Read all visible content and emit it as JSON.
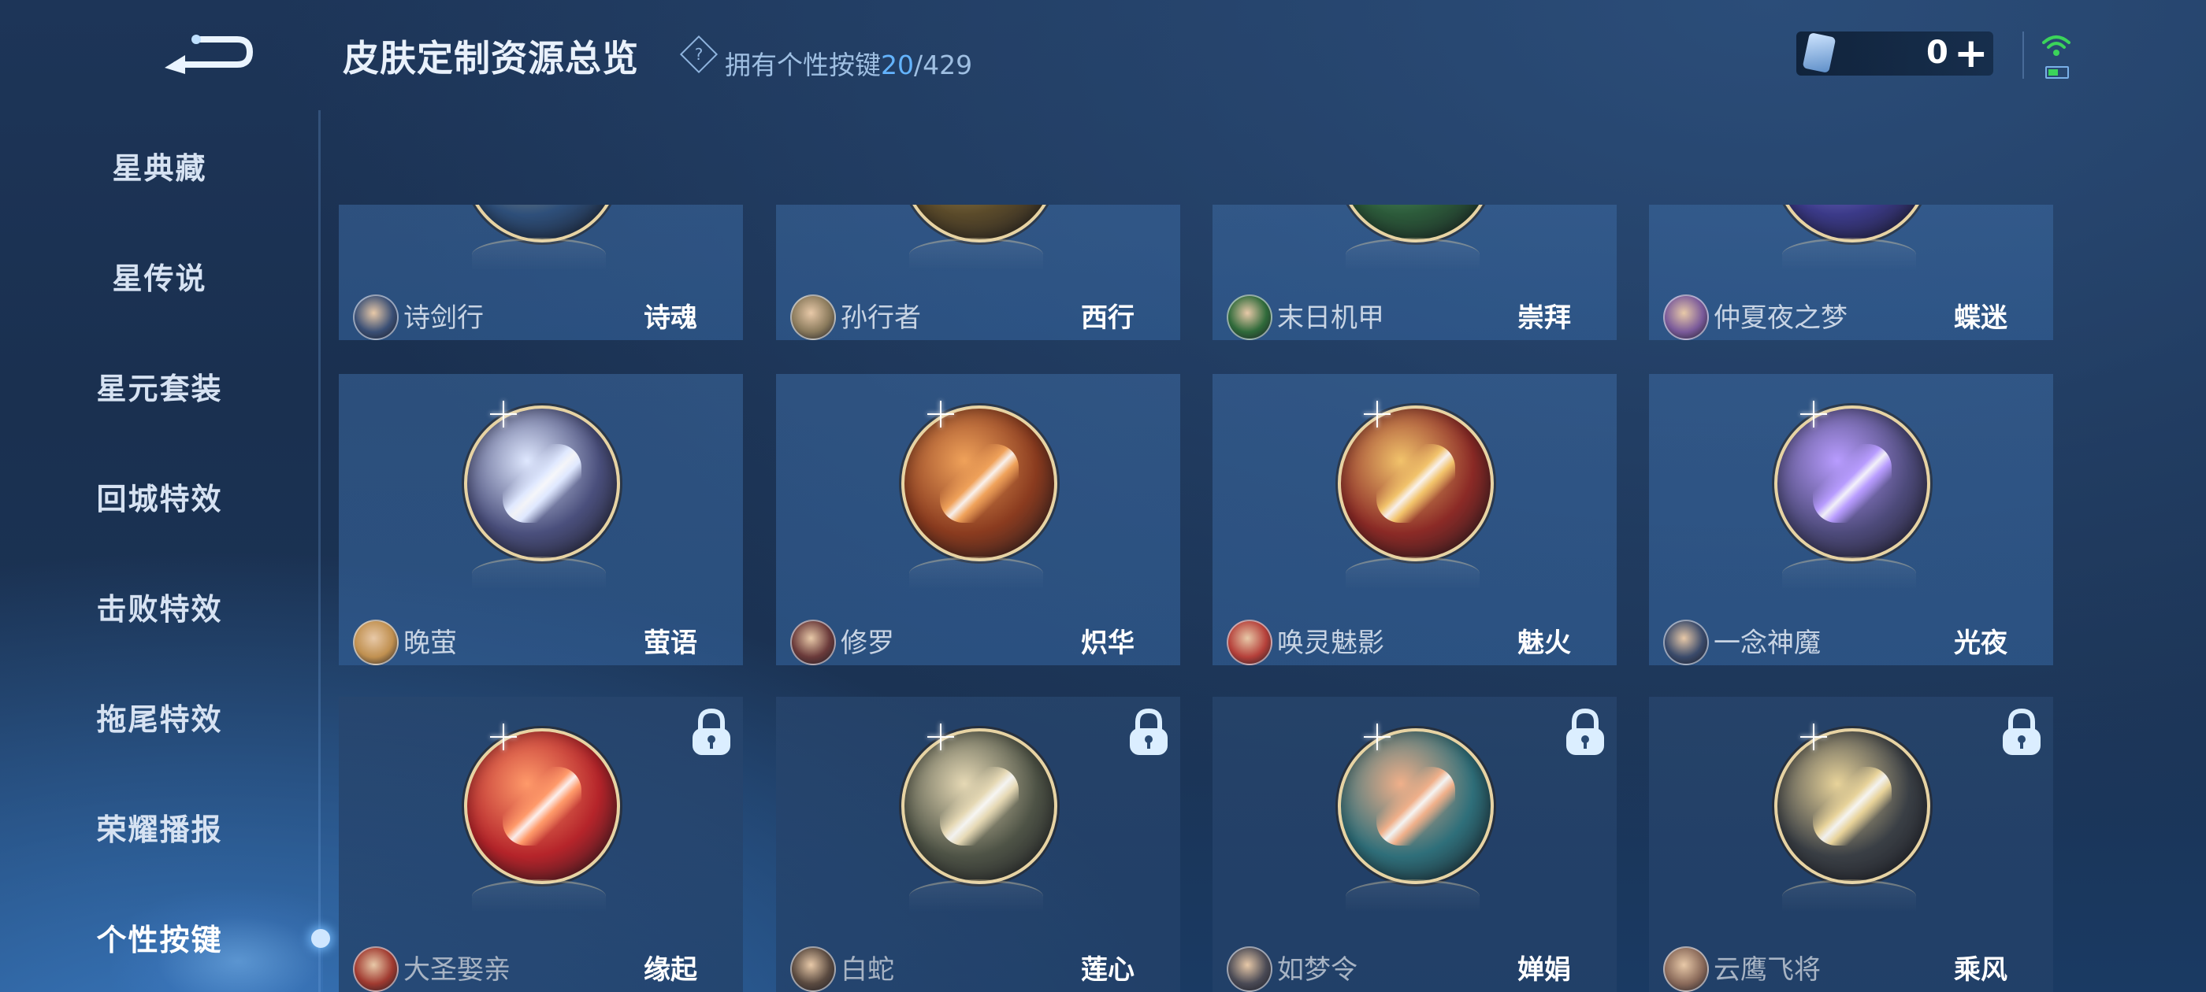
{
  "header": {
    "title": "皮肤定制资源总览",
    "help_symbol": "?",
    "owned_label": "拥有个性按键",
    "owned_count": "20",
    "owned_total": "/429"
  },
  "currency": {
    "value": "0",
    "plus": "+",
    "icon": "crystal-card-icon"
  },
  "status": {
    "wifi_color": "#3bd45a",
    "battery_color": "#3bd45a"
  },
  "sidebar": {
    "items": [
      {
        "label": "星典藏"
      },
      {
        "label": "星传说"
      },
      {
        "label": "星元套装"
      },
      {
        "label": "回城特效"
      },
      {
        "label": "击败特效"
      },
      {
        "label": "拖尾特效"
      },
      {
        "label": "荣耀播报"
      },
      {
        "label": "个性按键",
        "active": true
      }
    ]
  },
  "cards": [
    {
      "hero": "诗剑行",
      "skin": "诗魂",
      "locked": false
    },
    {
      "hero": "孙行者",
      "skin": "西行",
      "locked": false
    },
    {
      "hero": "末日机甲",
      "skin": "崇拜",
      "locked": false
    },
    {
      "hero": "仲夏夜之梦",
      "skin": "蝶迷",
      "locked": false
    },
    {
      "hero": "晚萤",
      "skin": "萤语",
      "locked": false
    },
    {
      "hero": "修罗",
      "skin": "炽华",
      "locked": false
    },
    {
      "hero": "唤灵魅影",
      "skin": "魅火",
      "locked": false
    },
    {
      "hero": "一念神魔",
      "skin": "光夜",
      "locked": false
    },
    {
      "hero": "大圣娶亲",
      "skin": "缘起",
      "locked": true
    },
    {
      "hero": "白蛇",
      "skin": "莲心",
      "locked": true
    },
    {
      "hero": "如梦令",
      "skin": "婵娟",
      "locked": true
    },
    {
      "hero": "云鹰飞将",
      "skin": "乘风",
      "locked": true
    }
  ]
}
